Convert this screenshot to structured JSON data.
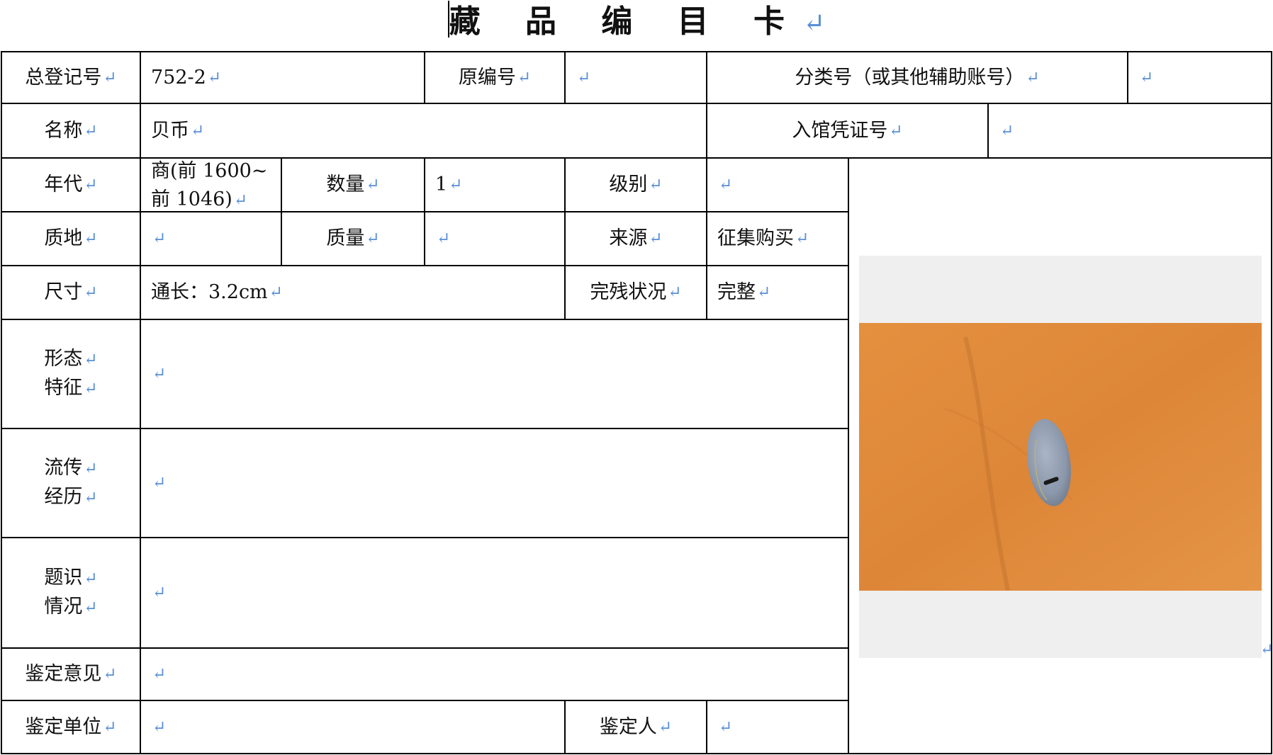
{
  "title": "藏 品 编 目 卡",
  "return_mark": "↵",
  "labels": {
    "registration_no": "总登记号",
    "original_no": "原编号",
    "classification_no": "分类号（或其他辅助账号）",
    "name": "名称",
    "entry_voucher_no": "入馆凭证号",
    "era": "年代",
    "quantity": "数量",
    "grade": "级别",
    "material": "质地",
    "mass": "质量",
    "source": "来源",
    "dimensions": "尺寸",
    "condition": "完残状况",
    "form_features_1": "形态",
    "form_features_2": "特征",
    "provenance_1": "流传",
    "provenance_2": "经历",
    "inscription_1": "题识",
    "inscription_2": "情况",
    "appraisal_opinion": "鉴定意见",
    "appraisal_unit": "鉴定单位",
    "appraiser": "鉴定人"
  },
  "values": {
    "registration_no": "752-2",
    "original_no": "",
    "classification_no": "",
    "name": "贝币",
    "entry_voucher_no": "",
    "era_line1": "商(前 1600~",
    "era_line2": "前 1046)",
    "quantity": "1",
    "grade": "",
    "material": "",
    "mass": "",
    "source": "征集购买",
    "dimensions": "通长：3.2cm",
    "condition": "完整",
    "form_features": "",
    "provenance": "",
    "inscription": "",
    "appraisal_opinion": "",
    "appraisal_unit": "",
    "appraiser": ""
  },
  "photo": {
    "subject": "cowrie-shell-coin",
    "background_color": "#e08a3c",
    "shell_color": "#8e9aae"
  }
}
